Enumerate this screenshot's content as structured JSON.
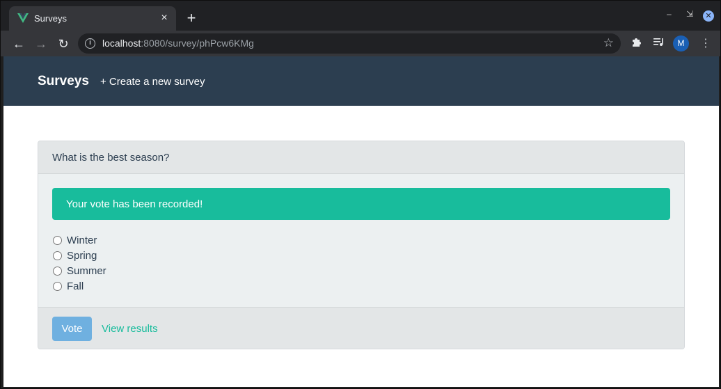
{
  "browser": {
    "tab_title": "Surveys",
    "tab_close": "×",
    "new_tab": "+",
    "url_host": "localhost",
    "url_rest": ":8080/survey/phPcw6KMg",
    "avatar_initial": "M"
  },
  "navbar": {
    "brand": "Surveys",
    "create_link": "+ Create a new survey"
  },
  "survey": {
    "question": "What is the best season?",
    "alert": "Your vote has been recorded!",
    "options": [
      "Winter",
      "Spring",
      "Summer",
      "Fall"
    ],
    "vote_button": "Vote",
    "results_link": "View results"
  },
  "colors": {
    "navbar_bg": "#2c3e50",
    "alert_bg": "#18bc9c",
    "vote_button_bg": "#6fb0e0",
    "link": "#18bc9c"
  }
}
